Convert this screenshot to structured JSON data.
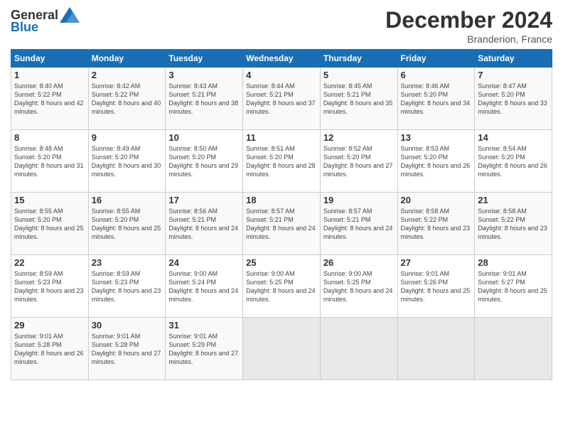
{
  "header": {
    "logo_general": "General",
    "logo_blue": "Blue",
    "month_title": "December 2024",
    "location": "Branderion, France"
  },
  "weekdays": [
    "Sunday",
    "Monday",
    "Tuesday",
    "Wednesday",
    "Thursday",
    "Friday",
    "Saturday"
  ],
  "weeks": [
    [
      {
        "day": "1",
        "rise": "Sunrise: 8:40 AM",
        "set": "Sunset: 5:22 PM",
        "daylight": "Daylight: 8 hours and 42 minutes."
      },
      {
        "day": "2",
        "rise": "Sunrise: 8:42 AM",
        "set": "Sunset: 5:22 PM",
        "daylight": "Daylight: 8 hours and 40 minutes."
      },
      {
        "day": "3",
        "rise": "Sunrise: 8:43 AM",
        "set": "Sunset: 5:21 PM",
        "daylight": "Daylight: 8 hours and 38 minutes."
      },
      {
        "day": "4",
        "rise": "Sunrise: 8:44 AM",
        "set": "Sunset: 5:21 PM",
        "daylight": "Daylight: 8 hours and 37 minutes."
      },
      {
        "day": "5",
        "rise": "Sunrise: 8:45 AM",
        "set": "Sunset: 5:21 PM",
        "daylight": "Daylight: 8 hours and 35 minutes."
      },
      {
        "day": "6",
        "rise": "Sunrise: 8:46 AM",
        "set": "Sunset: 5:20 PM",
        "daylight": "Daylight: 8 hours and 34 minutes."
      },
      {
        "day": "7",
        "rise": "Sunrise: 8:47 AM",
        "set": "Sunset: 5:20 PM",
        "daylight": "Daylight: 8 hours and 33 minutes."
      }
    ],
    [
      {
        "day": "8",
        "rise": "Sunrise: 8:48 AM",
        "set": "Sunset: 5:20 PM",
        "daylight": "Daylight: 8 hours and 31 minutes."
      },
      {
        "day": "9",
        "rise": "Sunrise: 8:49 AM",
        "set": "Sunset: 5:20 PM",
        "daylight": "Daylight: 8 hours and 30 minutes."
      },
      {
        "day": "10",
        "rise": "Sunrise: 8:50 AM",
        "set": "Sunset: 5:20 PM",
        "daylight": "Daylight: 8 hours and 29 minutes."
      },
      {
        "day": "11",
        "rise": "Sunrise: 8:51 AM",
        "set": "Sunset: 5:20 PM",
        "daylight": "Daylight: 8 hours and 28 minutes."
      },
      {
        "day": "12",
        "rise": "Sunrise: 8:52 AM",
        "set": "Sunset: 5:20 PM",
        "daylight": "Daylight: 8 hours and 27 minutes."
      },
      {
        "day": "13",
        "rise": "Sunrise: 8:53 AM",
        "set": "Sunset: 5:20 PM",
        "daylight": "Daylight: 8 hours and 26 minutes."
      },
      {
        "day": "14",
        "rise": "Sunrise: 8:54 AM",
        "set": "Sunset: 5:20 PM",
        "daylight": "Daylight: 8 hours and 26 minutes."
      }
    ],
    [
      {
        "day": "15",
        "rise": "Sunrise: 8:55 AM",
        "set": "Sunset: 5:20 PM",
        "daylight": "Daylight: 8 hours and 25 minutes."
      },
      {
        "day": "16",
        "rise": "Sunrise: 8:55 AM",
        "set": "Sunset: 5:20 PM",
        "daylight": "Daylight: 8 hours and 25 minutes."
      },
      {
        "day": "17",
        "rise": "Sunrise: 8:56 AM",
        "set": "Sunset: 5:21 PM",
        "daylight": "Daylight: 8 hours and 24 minutes."
      },
      {
        "day": "18",
        "rise": "Sunrise: 8:57 AM",
        "set": "Sunset: 5:21 PM",
        "daylight": "Daylight: 8 hours and 24 minutes."
      },
      {
        "day": "19",
        "rise": "Sunrise: 8:57 AM",
        "set": "Sunset: 5:21 PM",
        "daylight": "Daylight: 8 hours and 24 minutes."
      },
      {
        "day": "20",
        "rise": "Sunrise: 8:58 AM",
        "set": "Sunset: 5:22 PM",
        "daylight": "Daylight: 8 hours and 23 minutes."
      },
      {
        "day": "21",
        "rise": "Sunrise: 8:58 AM",
        "set": "Sunset: 5:22 PM",
        "daylight": "Daylight: 8 hours and 23 minutes."
      }
    ],
    [
      {
        "day": "22",
        "rise": "Sunrise: 8:59 AM",
        "set": "Sunset: 5:23 PM",
        "daylight": "Daylight: 8 hours and 23 minutes."
      },
      {
        "day": "23",
        "rise": "Sunrise: 8:59 AM",
        "set": "Sunset: 5:23 PM",
        "daylight": "Daylight: 8 hours and 23 minutes."
      },
      {
        "day": "24",
        "rise": "Sunrise: 9:00 AM",
        "set": "Sunset: 5:24 PM",
        "daylight": "Daylight: 8 hours and 24 minutes."
      },
      {
        "day": "25",
        "rise": "Sunrise: 9:00 AM",
        "set": "Sunset: 5:25 PM",
        "daylight": "Daylight: 8 hours and 24 minutes."
      },
      {
        "day": "26",
        "rise": "Sunrise: 9:00 AM",
        "set": "Sunset: 5:25 PM",
        "daylight": "Daylight: 8 hours and 24 minutes."
      },
      {
        "day": "27",
        "rise": "Sunrise: 9:01 AM",
        "set": "Sunset: 5:26 PM",
        "daylight": "Daylight: 8 hours and 25 minutes."
      },
      {
        "day": "28",
        "rise": "Sunrise: 9:01 AM",
        "set": "Sunset: 5:27 PM",
        "daylight": "Daylight: 8 hours and 25 minutes."
      }
    ],
    [
      {
        "day": "29",
        "rise": "Sunrise: 9:01 AM",
        "set": "Sunset: 5:28 PM",
        "daylight": "Daylight: 8 hours and 26 minutes."
      },
      {
        "day": "30",
        "rise": "Sunrise: 9:01 AM",
        "set": "Sunset: 5:28 PM",
        "daylight": "Daylight: 8 hours and 27 minutes."
      },
      {
        "day": "31",
        "rise": "Sunrise: 9:01 AM",
        "set": "Sunset: 5:29 PM",
        "daylight": "Daylight: 8 hours and 27 minutes."
      },
      null,
      null,
      null,
      null
    ]
  ]
}
